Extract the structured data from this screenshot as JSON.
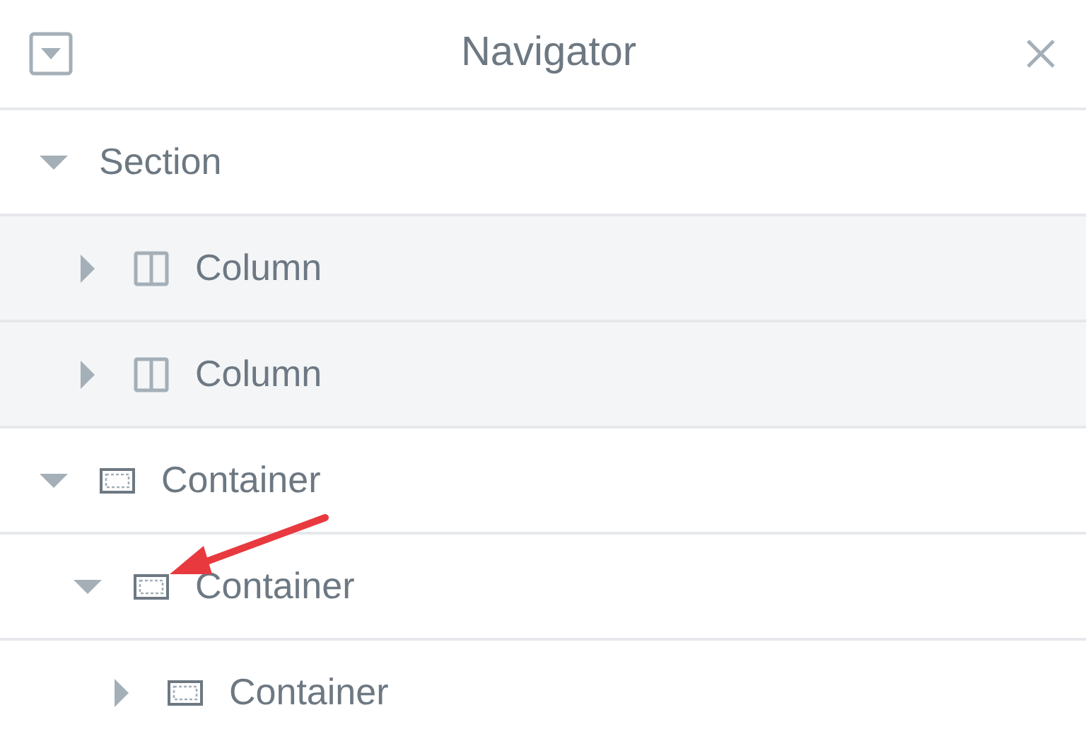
{
  "header": {
    "title": "Navigator"
  },
  "tree": [
    {
      "label": "Section",
      "kind": "section",
      "expanded": true,
      "highlighted": false,
      "children": [
        {
          "label": "Column",
          "kind": "column",
          "expanded": false,
          "highlighted": true
        },
        {
          "label": "Column",
          "kind": "column",
          "expanded": false,
          "highlighted": true
        }
      ]
    },
    {
      "label": "Container",
      "kind": "container",
      "expanded": true,
      "highlighted": false,
      "children": [
        {
          "label": "Container",
          "kind": "container",
          "expanded": true,
          "highlighted": false,
          "children": [
            {
              "label": "Container",
              "kind": "container",
              "expanded": false,
              "highlighted": false
            }
          ]
        }
      ]
    }
  ]
}
